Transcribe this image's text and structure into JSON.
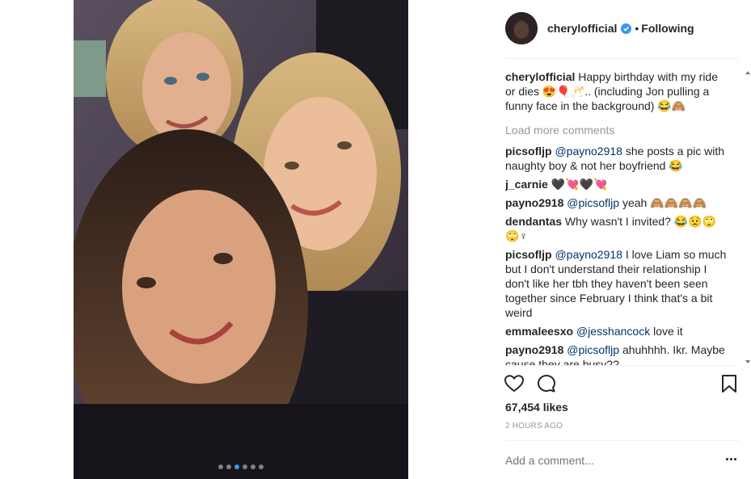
{
  "post": {
    "username": "cherylofficial",
    "separator": "•",
    "follow_label": "Following",
    "carousel": {
      "count": 6,
      "active_index": 2
    }
  },
  "caption": {
    "username": "cherylofficial",
    "text": "Happy birthday with my ride or dies 😍🎈🥂.. (including Jon pulling a funny face in the background) 😂🙈"
  },
  "load_more_label": "Load more comments",
  "comments": [
    {
      "user": "picsofljp",
      "mention": "@payno2918",
      "text": " she posts a pic with naughty boy & not her boyfriend 😂"
    },
    {
      "user": "j_carnie",
      "mention": "",
      "text": "🖤💘🖤💘"
    },
    {
      "user": "payno2918",
      "mention": "@picsofljp",
      "text": " yeah 🙈🙈🙈🙈"
    },
    {
      "user": "dendantas",
      "mention": "",
      "text": "Why wasn't I invited? 😂😟🙄🙄♀"
    },
    {
      "user": "picsofljp",
      "mention": "@payno2918",
      "text": " I love Liam so much but I don't understand their relationship I don't like her tbh they haven't been seen together since February I think that's a bit weird"
    },
    {
      "user": "emmaleesxo",
      "mention": "@jesshancock",
      "text": " love it"
    },
    {
      "user": "payno2918",
      "mention": "@picsofljp",
      "text": " ahuhhhh. Ikr. Maybe cause they are busy??"
    }
  ],
  "likes": "67,454 likes",
  "timestamp": "2 HOURS AGO",
  "add_comment_placeholder": "Add a comment...",
  "icons": {
    "like": "heart-icon",
    "comment": "comment-icon",
    "save": "bookmark-icon",
    "more": "more-options-icon",
    "verified": "verified-badge-icon"
  },
  "colors": {
    "verified_blue": "#3897f0",
    "mention": "#003569",
    "muted": "#999999",
    "text": "#262626"
  }
}
